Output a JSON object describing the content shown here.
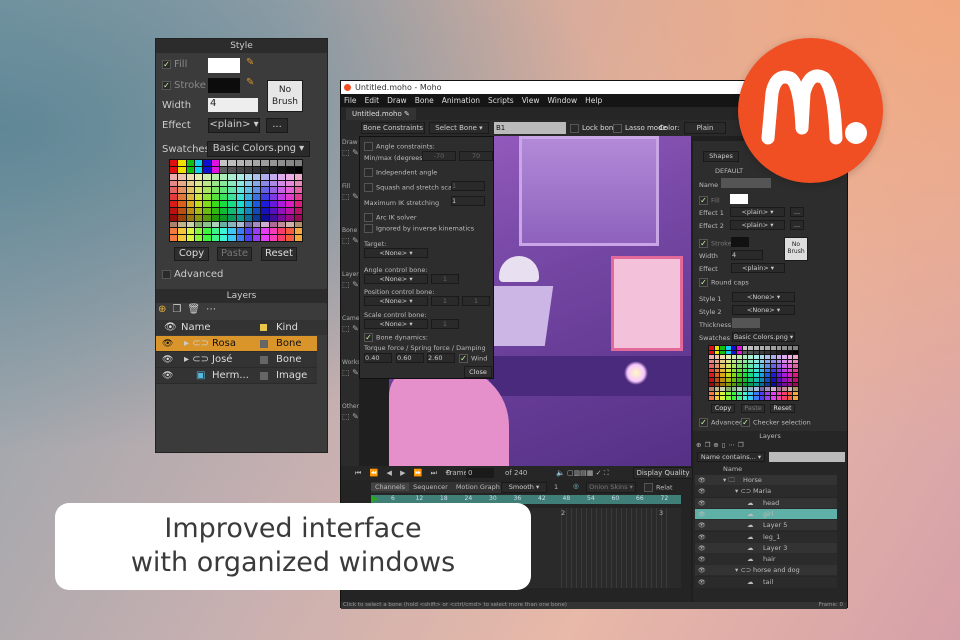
{
  "left_panel": {
    "style_title": "Style",
    "fill_label": "Fill",
    "stroke_label": "Stroke",
    "width_label": "Width",
    "width_value": "4",
    "no_brush": "No Brush",
    "effect_label": "Effect",
    "effect_value": "<plain>",
    "more": "...",
    "swatches_label": "Swatches",
    "swatches_value": "Basic Colors.png",
    "copy": "Copy",
    "paste": "Paste",
    "reset": "Reset",
    "advanced": "Advanced",
    "layers_title": "Layers",
    "col_name": "Name",
    "col_kind": "Kind",
    "layers": [
      {
        "name": "Rosa",
        "kind": "Bone",
        "selected": true
      },
      {
        "name": "José",
        "kind": "Bone"
      },
      {
        "name": "Herm...",
        "kind": "Image"
      }
    ]
  },
  "window": {
    "title": "Untitled.moho - Moho",
    "menu": [
      "File",
      "Edit",
      "Draw",
      "Bone",
      "Animation",
      "Scripts",
      "View",
      "Window",
      "Help"
    ],
    "doc_tab": "Untitled.moho",
    "toolbar": {
      "bone_constraints": "Bone Constraints",
      "select_bone": "Select Bone",
      "bone_name": "B1",
      "lock_bone": "Lock bone",
      "lasso_mode": "Lasso mode",
      "color_label": "Color:",
      "color_value": "Plain"
    },
    "tool_groups": [
      "Draw",
      "Fill",
      "Bone",
      "Layer",
      "Camera",
      "Workspace",
      "Other"
    ],
    "constraints": {
      "angle_constraints": "Angle constraints:",
      "minmax": "Min/max (degrees)",
      "min": "-70",
      "max": "70",
      "independent_angle": "Independent angle",
      "squash": "Squash and stretch scaling",
      "squash_value": "1",
      "max_ik": "Maximum IK stretching",
      "max_ik_value": "1",
      "arc_ik": "Arc IK solver",
      "ignored_ik": "Ignored by inverse kinematics",
      "target": "Target:",
      "none": "<None>",
      "angle_control": "Angle control bone:",
      "position_control": "Position control bone:",
      "scale_control": "Scale control bone:",
      "one": "1",
      "bone_dynamics": "Bone dynamics:",
      "forces_label": "Torque force / Spring force / Damping force",
      "torque": "0.40",
      "spring": "0.60",
      "damping": "2.60",
      "wind": "Wind",
      "close": "Close"
    },
    "playback": {
      "frame_label": "Frame",
      "frame_value": "0",
      "of_label": "of",
      "total": "240",
      "display_quality": "Display Quality"
    },
    "timeline": {
      "tabs": [
        "Channels",
        "Sequencer",
        "Motion Graph"
      ],
      "interp": "Smooth",
      "step": "1",
      "onion": "Onion Skins",
      "relative": "Relat",
      "ticks": [
        "6",
        "12",
        "18",
        "24",
        "30",
        "36",
        "42",
        "48",
        "54",
        "60",
        "66",
        "72"
      ],
      "markers": [
        "2",
        "3"
      ]
    },
    "status": "Click to select a bone (hold <shift> or <ctrl/cmd> to select more than one bone)",
    "status_right": "Frame: 0"
  },
  "right_panel": {
    "tab": "Shapes",
    "default_label": "DEFAULT",
    "name_label": "Name",
    "fill": "Fill",
    "effect1": "Effect 1",
    "effect2": "Effect 2",
    "plain": "<plain>",
    "more": "...",
    "stroke": "Stroke",
    "width": "Width",
    "width_value": "4",
    "no_brush": "No Brush",
    "effect": "Effect",
    "round_caps": "Round caps",
    "style1": "Style 1",
    "style2": "Style 2",
    "none": "<None>",
    "thickness": "Thickness",
    "swatches": "Swatches",
    "swatches_value": "Basic Colors.png",
    "copy": "Copy",
    "paste": "Paste",
    "reset": "Reset",
    "advanced": "Advanced",
    "checker": "Checker selection",
    "layers_title": "Layers",
    "name_contains": "Name contains...",
    "col_name": "Name",
    "layers": [
      {
        "name": "Horse",
        "depth": 0,
        "icon": "folder"
      },
      {
        "name": "Maria",
        "depth": 1,
        "icon": "bone"
      },
      {
        "name": "head",
        "depth": 2,
        "icon": "vector"
      },
      {
        "name": "girl",
        "depth": 2,
        "icon": "vector",
        "selected": true
      },
      {
        "name": "Layer 5",
        "depth": 2,
        "icon": "vector"
      },
      {
        "name": "leg_1",
        "depth": 2,
        "icon": "vector"
      },
      {
        "name": "Layer 3",
        "depth": 2,
        "icon": "vector"
      },
      {
        "name": "hair",
        "depth": 2,
        "icon": "vector"
      },
      {
        "name": "horse and dog",
        "depth": 1,
        "icon": "bone"
      },
      {
        "name": "tail",
        "depth": 2,
        "icon": "vector"
      }
    ]
  },
  "caption": {
    "line1": "Improved interface",
    "line2": "with organized windows"
  },
  "colors": {
    "accent_orange": "#f04e23",
    "selection_gold": "#d9952a",
    "selection_teal": "#5fb0a6"
  }
}
